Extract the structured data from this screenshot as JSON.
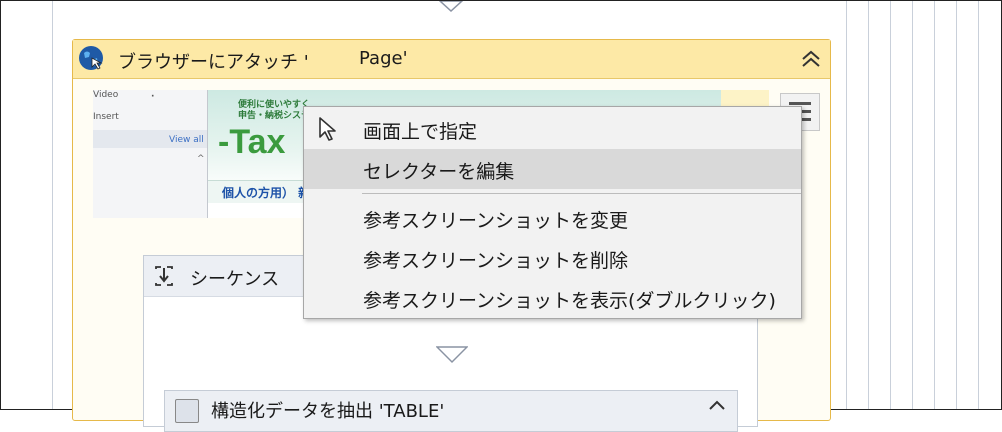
{
  "attach_browser": {
    "title": "ブラウザーにアタッチ '",
    "page": "Page'",
    "screenshot": {
      "left_panel": {
        "video": "Video",
        "insert": "Insert",
        "view_all": "View all"
      },
      "logo_small_1": "便利に使いやすく",
      "logo_small_2": "申告・納税システム",
      "logo_text": "-Tax",
      "link_text": "個人の方用）  新"
    }
  },
  "context_menu": {
    "items": [
      {
        "label": "画面上で指定",
        "icon": "cursor-icon"
      },
      {
        "label": "セレクターを編集",
        "highlighted": true
      },
      {
        "label": "参考スクリーンショットを変更"
      },
      {
        "label": "参考スクリーンショットを削除"
      },
      {
        "label": "参考スクリーンショットを表示(ダブルクリック)"
      }
    ]
  },
  "sequence": {
    "title": "シーケンス"
  },
  "extract": {
    "title": "構造化データを抽出 'TABLE'"
  },
  "colors": {
    "attach_header": "#fde9a6",
    "attach_border": "#e6b94a",
    "menu_background": "#f2f2f2",
    "menu_highlight": "#d9d9d9",
    "sequence_header": "#eceff4"
  }
}
